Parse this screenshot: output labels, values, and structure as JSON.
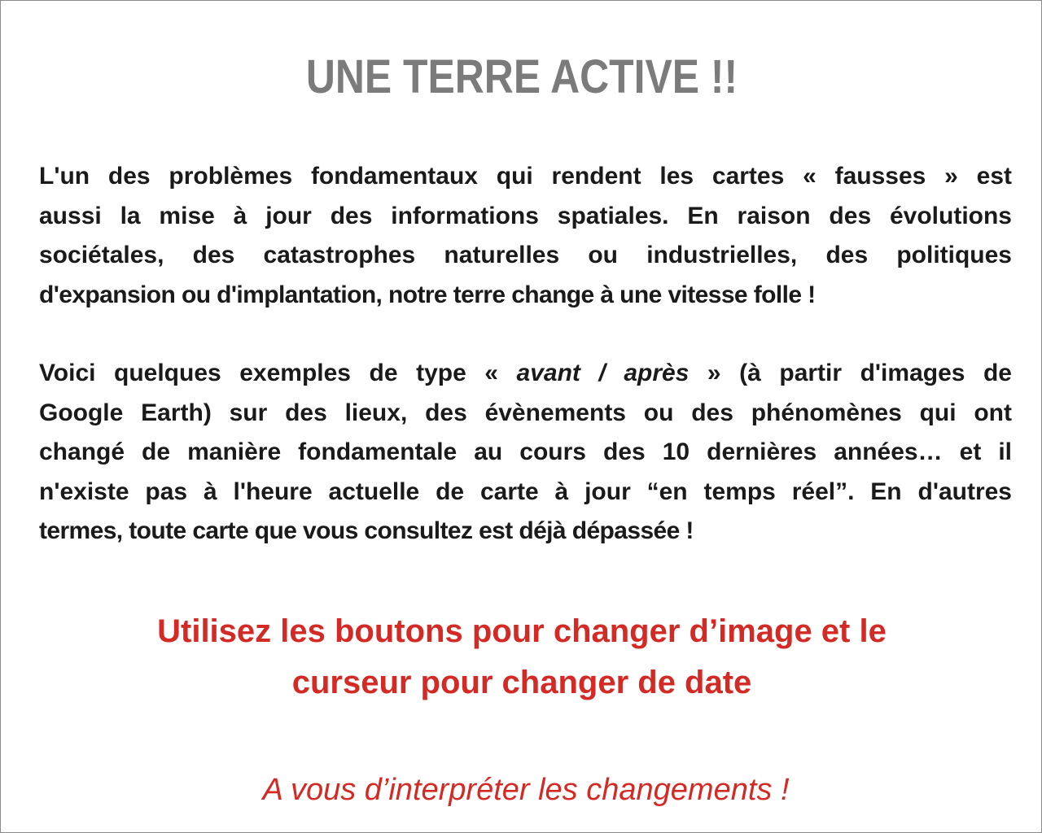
{
  "title": "UNE TERRE ACTIVE !!",
  "paragraph1": {
    "lines": [
      "L'un des problèmes fondamentaux qui rendent les cartes « fausses » est",
      "aussi la mise à jour des informations spatiales. En raison des évolutions",
      "sociétales, des catastrophes naturelles ou industrielles, des politiques",
      "d'expansion ou d'implantation, notre terre change à une vitesse folle !"
    ]
  },
  "paragraph2": {
    "line1_start": "Voici quelques exemples de type « ",
    "line1_italic": "avant / après",
    "line1_end": " » (à partir d'images de",
    "lines": [
      "Google Earth) sur des lieux, des évènements ou des phénomènes qui ont",
      "changé de manière fondamentale au cours des 10 dernières années… et il",
      "n'existe pas à l'heure actuelle de carte à jour “en temps réel”. En d'autres",
      "termes, toute carte que vous consultez est déjà dépassée !"
    ]
  },
  "instruction": {
    "line1": "Utilisez les boutons pour changer d’image et le",
    "line2": "curseur pour changer de date"
  },
  "closing": "A vous d’interpréter les changements !",
  "colors": {
    "title": "#7b7b7b",
    "body": "#1a1a1a",
    "accent": "#d42a25",
    "border": "#8a8a8a"
  }
}
